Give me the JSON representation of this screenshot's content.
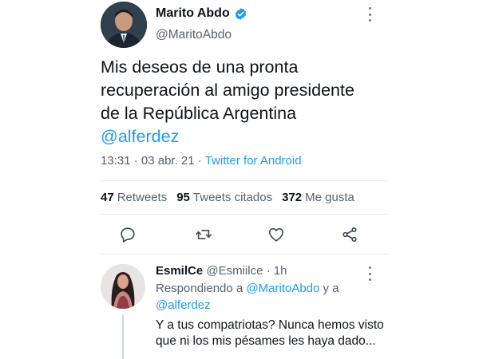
{
  "tweet": {
    "author_name": "Marito Abdo",
    "author_handle": "@MaritoAbdo",
    "text_line1": "Mis deseos de una pronta",
    "text_line2": "recuperación al amigo presidente",
    "text_line3": "de la República Argentina",
    "mention": "@alferdez",
    "time": "13:31",
    "date": "03 abr. 21",
    "separator": " · ",
    "source": "Twitter for Android",
    "icons": {
      "verified": "verified-badge-icon",
      "more": "more-options-icon"
    }
  },
  "stats": {
    "retweets_count": "47",
    "retweets_label": "Retweets",
    "quotes_count": "95",
    "quotes_label": "Tweets citados",
    "likes_count": "372",
    "likes_label": "Me gusta"
  },
  "actions": {
    "icons": [
      "reply-icon",
      "retweet-icon",
      "like-icon",
      "share-icon"
    ]
  },
  "reply": {
    "author_name": "EsmilCe",
    "author_handle": "@Esmiilce",
    "separator": " · ",
    "age": "1h",
    "replying_prefix": "Respondiendo a ",
    "replying_mention1": "@MaritoAbdo",
    "replying_and": " y a",
    "replying_mention2": "@alferdez",
    "text": "Y a tus compatriotas? Nunca hemos visto que ni los mis pésames les haya dado..."
  },
  "colors": {
    "link_blue": "#1d9bf0",
    "text_primary": "#0f1419",
    "text_secondary": "#536471",
    "divider": "#e6ecf0"
  }
}
